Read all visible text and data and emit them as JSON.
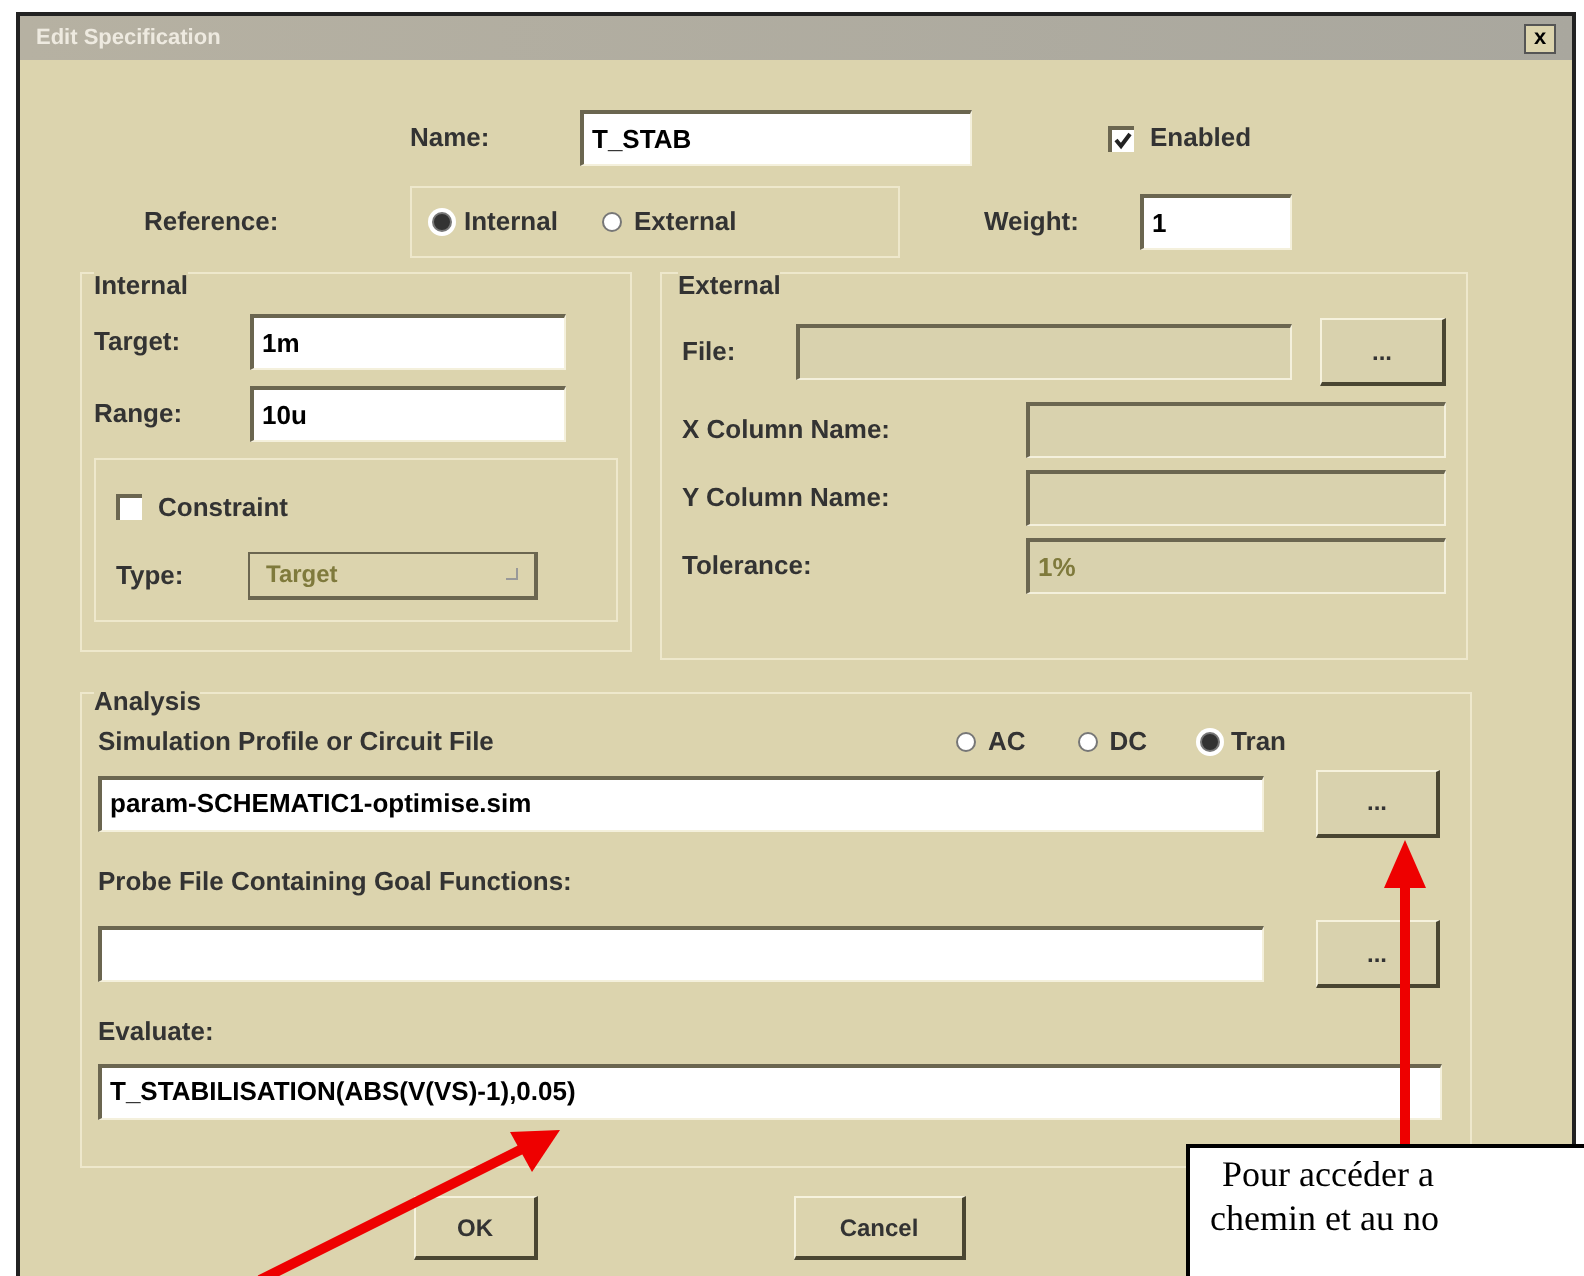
{
  "window": {
    "title": "Edit Specification",
    "close": "x"
  },
  "name": {
    "label": "Name:",
    "value": "T_STAB"
  },
  "enabled": {
    "label": "Enabled",
    "checked": true
  },
  "reference": {
    "label": "Reference:",
    "options": [
      {
        "label": "Internal",
        "selected": true
      },
      {
        "label": "External",
        "selected": false
      }
    ]
  },
  "weight": {
    "label": "Weight:",
    "value": "1"
  },
  "internal": {
    "title": "Internal",
    "target": {
      "label": "Target:",
      "value": "1m"
    },
    "range": {
      "label": "Range:",
      "value": "10u"
    },
    "constraint": {
      "label": "Constraint",
      "checked": false
    },
    "type": {
      "label": "Type:",
      "value": "Target",
      "disabled": true
    }
  },
  "external": {
    "title": "External",
    "file_label": "File:",
    "browse": "...",
    "x_column_label": "X Column Name:",
    "y_column_label": "Y Column Name:",
    "tolerance": {
      "label": "Tolerance:",
      "value": "1%",
      "disabled": true
    }
  },
  "analysis": {
    "title": "Analysis",
    "profile_label": "Simulation Profile or Circuit File",
    "modes": [
      {
        "label": "AC",
        "selected": false
      },
      {
        "label": "DC",
        "selected": false
      },
      {
        "label": "Tran",
        "selected": true
      }
    ],
    "profile_value": "param-SCHEMATIC1-optimise.sim",
    "profile_browse": "...",
    "probe_label": "Probe File Containing Goal Functions:",
    "probe_browse": "...",
    "evaluate_label": "Evaluate:",
    "evaluate_value": "T_STABILISATION(ABS(V(VS)-1),0.05)"
  },
  "buttons": [
    "OK",
    "Cancel"
  ],
  "annotation": {
    "lines": [
      "Pour accéder a",
      "chemin et au no"
    ]
  }
}
